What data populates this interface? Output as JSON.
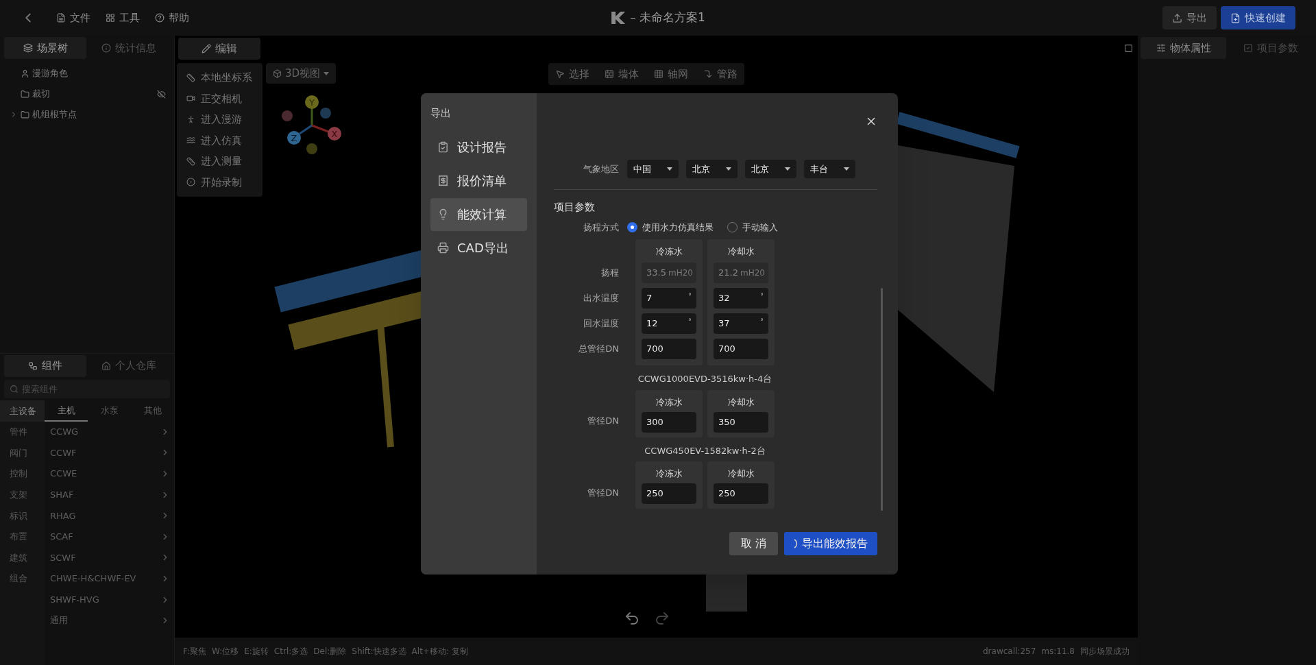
{
  "topbar": {
    "menus": [
      "文件",
      "工具",
      "帮助"
    ],
    "title": "– 未命名方案1",
    "actions": [
      {
        "label": "导出",
        "kind": "secondary"
      },
      {
        "label": "快速创建",
        "kind": "primary"
      }
    ]
  },
  "scene_panel": {
    "tabs": [
      {
        "label": "场景树",
        "selected": true
      },
      {
        "label": "统计信息",
        "selected": false
      }
    ],
    "tree": [
      {
        "label": "漫游角色",
        "kind": "character",
        "hidden": false
      },
      {
        "label": "裁切",
        "kind": "folder",
        "hidden": true
      },
      {
        "label": "机组根节点",
        "kind": "folder",
        "hidden": false,
        "expanded": false
      }
    ]
  },
  "components": {
    "tabs": [
      {
        "label": "组件",
        "selected": true
      },
      {
        "label": "个人仓库",
        "selected": false
      }
    ],
    "search": {
      "placeholder": "搜索组件"
    },
    "categories": [
      {
        "label": "主设备",
        "selected": true
      },
      {
        "label": "管件",
        "selected": false
      },
      {
        "label": "阀门",
        "selected": false
      },
      {
        "label": "控制",
        "selected": false
      },
      {
        "label": "支架",
        "selected": false
      },
      {
        "label": "标识",
        "selected": false
      },
      {
        "label": "布置",
        "selected": false
      },
      {
        "label": "建筑",
        "selected": false
      },
      {
        "label": "组合",
        "selected": false
      }
    ],
    "subtabs": [
      {
        "label": "主机",
        "selected": true
      },
      {
        "label": "水泵",
        "selected": false
      },
      {
        "label": "其他",
        "selected": false
      }
    ],
    "items": [
      "CCWG",
      "CCWF",
      "CCWE",
      "SHAF",
      "RHAG",
      "SCAF",
      "SCWF",
      "CHWE-H&CHWF-EV",
      "SHWF-HVG",
      "通用"
    ]
  },
  "edit_panel": {
    "tab": {
      "label": "编辑",
      "selected": true
    },
    "items": [
      "本地坐标系",
      "正交相机",
      "进入漫游",
      "进入仿真",
      "进入测量",
      "开始录制"
    ]
  },
  "view_dropdown": "3D视图",
  "gizmo": {
    "y": "Y",
    "x": "X",
    "z": "Z"
  },
  "toolbar": [
    "选择",
    "墙体",
    "轴网",
    "管路"
  ],
  "right_panel": {
    "tabs": [
      {
        "label": "物体属性",
        "selected": true
      },
      {
        "label": "项目参数",
        "selected": false
      }
    ]
  },
  "dialog": {
    "title": "导出",
    "nav": [
      {
        "label": "设计报告",
        "selected": false
      },
      {
        "label": "报价清单",
        "selected": false
      },
      {
        "label": "能效计算",
        "selected": true
      },
      {
        "label": "CAD导出",
        "selected": false
      }
    ],
    "weather": {
      "label": "气象地区",
      "selects": [
        "中国",
        "北京",
        "北京",
        "丰台"
      ]
    },
    "section": "项目参数",
    "head_mode": {
      "label": "扬程方式",
      "options": [
        {
          "label": "使用水力仿真结果",
          "selected": true
        },
        {
          "label": "手动输入",
          "selected": false
        }
      ]
    },
    "main_table": {
      "columns": [
        "冷冻水",
        "冷却水"
      ],
      "rows": [
        {
          "label": "扬程",
          "disabled": true,
          "cells": [
            {
              "value": "33.5",
              "unit": "mH20"
            },
            {
              "value": "21.2",
              "unit": "mH20"
            }
          ]
        },
        {
          "label": "出水温度",
          "disabled": false,
          "cells": [
            {
              "value": "7",
              "unit": "°"
            },
            {
              "value": "32",
              "unit": "°"
            }
          ]
        },
        {
          "label": "回水温度",
          "disabled": false,
          "cells": [
            {
              "value": "12",
              "unit": "°"
            },
            {
              "value": "37",
              "unit": "°"
            }
          ]
        },
        {
          "label": "总管径DN",
          "disabled": false,
          "cells": [
            {
              "value": "700"
            },
            {
              "value": "700"
            }
          ]
        }
      ]
    },
    "units": [
      {
        "title": "CCWG1000EVD-3516kw·h-4台",
        "columns": [
          "冷冻水",
          "冷却水"
        ],
        "row_label": "管径DN",
        "values": [
          "300",
          "350"
        ]
      },
      {
        "title": "CCWG450EV-1582kw·h-2台",
        "columns": [
          "冷冻水",
          "冷却水"
        ],
        "row_label": "管径DN",
        "values": [
          "250",
          "250"
        ]
      }
    ],
    "buttons": [
      {
        "label": "取 消",
        "kind": "secondary",
        "loading": false
      },
      {
        "label": "导出能效报告",
        "kind": "primary",
        "loading": true
      }
    ]
  },
  "status_bar": {
    "shortcuts": [
      "F:聚焦",
      "W:位移",
      "E:旋转",
      "Ctrl:多选",
      "Del:删除",
      "Shift:快速多选",
      "Alt+移动: 复制"
    ],
    "info": [
      "drawcall:257",
      "ms:11.8",
      "同步场景成功"
    ]
  }
}
